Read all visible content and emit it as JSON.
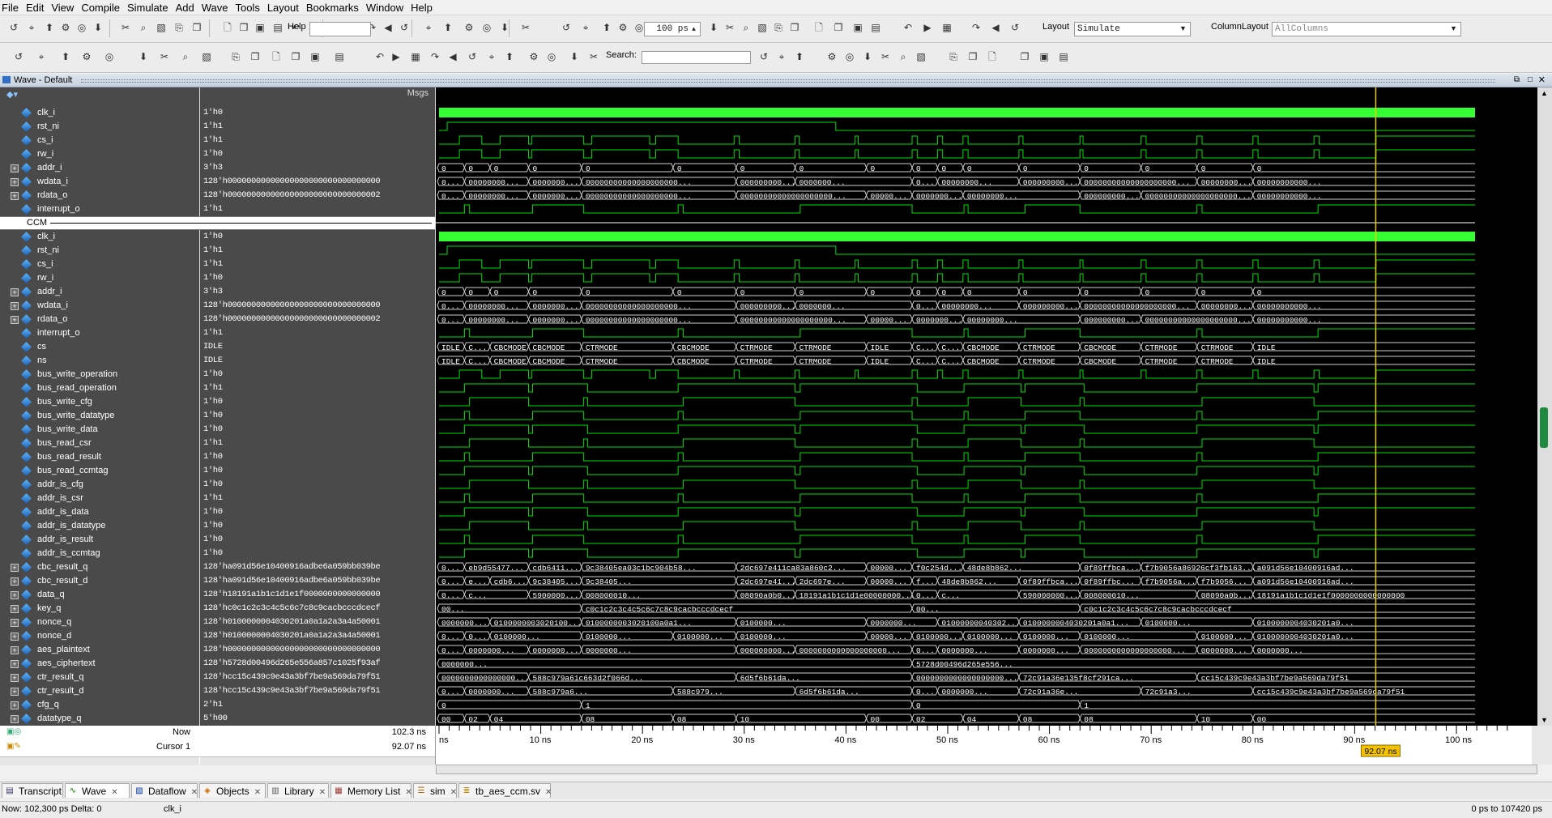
{
  "menu": [
    "File",
    "Edit",
    "View",
    "Compile",
    "Simulate",
    "Add",
    "Wave",
    "Tools",
    "Layout",
    "Bookmarks",
    "Window",
    "Help"
  ],
  "toolbar": {
    "help_label": "Help",
    "time_value": "100 ps",
    "layout_label": "Layout",
    "layout_value": "Simulate",
    "column_layout_label": "ColumnLayout",
    "column_layout_value": "AllColumns",
    "search_label": "Search:"
  },
  "wave_window": {
    "title": "Wave - Default",
    "msgs_header": "Msgs",
    "divider_label": "CCM",
    "signals_top": [
      {
        "name": "clk_i",
        "value": "1'h0",
        "expandable": false
      },
      {
        "name": "rst_ni",
        "value": "1'h1",
        "expandable": false
      },
      {
        "name": "cs_i",
        "value": "1'h1",
        "expandable": false
      },
      {
        "name": "rw_i",
        "value": "1'h0",
        "expandable": false
      },
      {
        "name": "addr_i",
        "value": "3'h3",
        "expandable": true
      },
      {
        "name": "wdata_i",
        "value": "128'h00000000000000000000000000000000",
        "expandable": true
      },
      {
        "name": "rdata_o",
        "value": "128'h00000000000000000000000000000002",
        "expandable": true
      },
      {
        "name": "interrupt_o",
        "value": "1'h1",
        "expandable": false
      }
    ],
    "signals_ccm": [
      {
        "name": "clk_i",
        "value": "1'h0",
        "expandable": false
      },
      {
        "name": "rst_ni",
        "value": "1'h1",
        "expandable": false
      },
      {
        "name": "cs_i",
        "value": "1'h1",
        "expandable": false
      },
      {
        "name": "rw_i",
        "value": "1'h0",
        "expandable": false
      },
      {
        "name": "addr_i",
        "value": "3'h3",
        "expandable": true
      },
      {
        "name": "wdata_i",
        "value": "128'h00000000000000000000000000000000",
        "expandable": true
      },
      {
        "name": "rdata_o",
        "value": "128'h00000000000000000000000000000002",
        "expandable": true
      },
      {
        "name": "interrupt_o",
        "value": "1'h1",
        "expandable": false
      },
      {
        "name": "cs",
        "value": "IDLE",
        "expandable": false
      },
      {
        "name": "ns",
        "value": "IDLE",
        "expandable": false
      },
      {
        "name": "bus_write_operation",
        "value": "1'h0",
        "expandable": false
      },
      {
        "name": "bus_read_operation",
        "value": "1'h1",
        "expandable": false
      },
      {
        "name": "bus_write_cfg",
        "value": "1'h0",
        "expandable": false
      },
      {
        "name": "bus_write_datatype",
        "value": "1'h0",
        "expandable": false
      },
      {
        "name": "bus_write_data",
        "value": "1'h0",
        "expandable": false
      },
      {
        "name": "bus_read_csr",
        "value": "1'h1",
        "expandable": false
      },
      {
        "name": "bus_read_result",
        "value": "1'h0",
        "expandable": false
      },
      {
        "name": "bus_read_ccmtag",
        "value": "1'h0",
        "expandable": false
      },
      {
        "name": "addr_is_cfg",
        "value": "1'h0",
        "expandable": false
      },
      {
        "name": "addr_is_csr",
        "value": "1'h1",
        "expandable": false
      },
      {
        "name": "addr_is_data",
        "value": "1'h0",
        "expandable": false
      },
      {
        "name": "addr_is_datatype",
        "value": "1'h0",
        "expandable": false
      },
      {
        "name": "addr_is_result",
        "value": "1'h0",
        "expandable": false
      },
      {
        "name": "addr_is_ccmtag",
        "value": "1'h0",
        "expandable": false
      },
      {
        "name": "cbc_result_q",
        "value": "128'ha091d56e10400916adbe6a059bb039be",
        "expandable": true
      },
      {
        "name": "cbc_result_d",
        "value": "128'ha091d56e10400916adbe6a059bb039be",
        "expandable": true
      },
      {
        "name": "data_q",
        "value": "128'h18191a1b1c1d1e1f0000000000000000",
        "expandable": true
      },
      {
        "name": "key_q",
        "value": "128'hc0c1c2c3c4c5c6c7c8c9cacbcccdcecf",
        "expandable": true
      },
      {
        "name": "nonce_q",
        "value": "128'h0100000004030201a0a1a2a3a4a50001",
        "expandable": true
      },
      {
        "name": "nonce_d",
        "value": "128'h0100000004030201a0a1a2a3a4a50001",
        "expandable": true
      },
      {
        "name": "aes_plaintext",
        "value": "128'h00000000000000000000000000000000",
        "expandable": true
      },
      {
        "name": "aes_ciphertext",
        "value": "128'h5728d00496d265e556a857c1025f93af",
        "expandable": true
      },
      {
        "name": "ctr_result_q",
        "value": "128'hcc15c439c9e43a3bf7be9a569da79f51",
        "expandable": true
      },
      {
        "name": "ctr_result_d",
        "value": "128'hcc15c439c9e43a3bf7be9a569da79f51",
        "expandable": true
      },
      {
        "name": "cfg_q",
        "value": "2'h1",
        "expandable": true
      },
      {
        "name": "datatype_q",
        "value": "5'h00",
        "expandable": true
      }
    ],
    "bus_labels": {
      "addr_i": [
        "0",
        "0",
        "0",
        "0",
        "0",
        "0",
        "0",
        "0",
        "0",
        "0",
        "0",
        "0",
        "0",
        "0",
        "0",
        "0",
        "0"
      ],
      "wdata_i": [
        "000000...",
        "00000000...",
        "00000000...",
        "00000000000000000000...",
        "00000000000000000000...",
        "0000000...",
        "00000000000...",
        "00000000...",
        "00000000000000000000...",
        "00000000000000000000...",
        "00000000000000000000...",
        "00000000000..."
      ],
      "rdata_o": [
        "000000...",
        "00000000...",
        "00000000...",
        "00000000000000000000...",
        "00000000000000000000...",
        "0000000...",
        "00000000...",
        "00000000...",
        "00000000000000000000...",
        "00000000000000000000...",
        "00000000000..."
      ],
      "cs": [
        "IDLE",
        "CBCMODE",
        "CBCMODE",
        "CBCMODE",
        "CTRMODE",
        "CBCMODE",
        "CTRMODE",
        "CTRMODE",
        "IDLE",
        "CBCMODE",
        "CBCMODE",
        "CBCMODE",
        "CTRMODE",
        "CBCMODE",
        "CTRMODE",
        "CTRMODE",
        "IDLE"
      ],
      "cbc_result_q": [
        "000000000000000000...",
        "eb9d55477...",
        "cdb6411e3...",
        "9c38405ea03c1bc904b58...",
        "2dc697e411ca83a860c2...",
        "000000000000000000...",
        "f0c254d3c...",
        "48de8b862...",
        "0f89ffbca62bc24f13215f...",
        "f7b9056a86926cf3fb163...",
        "a091d56e10400916ad..."
      ],
      "cbc_result_d": [
        "000000000000000000...",
        "eb9d55477...",
        "cdb6411e3...",
        "9c38405ea0...",
        "9c38405...",
        "2dc697e41...",
        "2dc697e...",
        "000000000000000000...",
        "f0c254d3c...",
        "48de8b862...",
        "0f89ffbca62...",
        "0f89ffbc...",
        "f7b9056a8...",
        "f7b9056...",
        "a091d56e10400916ad..."
      ],
      "data_q": [
        "0...",
        "c...",
        "590000000...",
        "008000010...",
        "08090a0b0c0d0e0f10111...",
        "18191a1b1c1d1e000000000000000000",
        "0...",
        "c...",
        "590000000...",
        "008000010...",
        "08090a0b0c0d0e0f10111...",
        "18191a1b1c1d1e1f0000000000000000"
      ],
      "key_q": [
        "00...",
        "c0c1c2c3c4c5c6c7c8c9cacbcccdcecf",
        "00...",
        "c0c1c2c3c4c5c6c7c8c9cacbcccdcecf"
      ],
      "nonce_q": [
        "0000000...",
        "0100000003020100a0a1a2a3a4a50001",
        "0100000003020100a0a1...",
        "0100000...",
        "0000000...",
        "0100000004030201a0a1a2a3a4a50001",
        "0100000004030201a0a1...",
        "0100000...",
        "0100000004030201a0..."
      ],
      "nonce_d": [
        "0000000...",
        "0100000003020100a0a1a2a3a4a50001",
        "0100000...",
        "0100000...",
        "0100000...",
        "0100000...",
        "0000000...",
        "0100000004030201a0a1a2a3a4a50001",
        "0100000...",
        "0100000...",
        "0100000...",
        "0100000...",
        "0100000004030201a0..."
      ],
      "aes_plaintext": [
        "0000000...",
        "0000000...",
        "0000000...",
        "0000000...",
        "0000000000000000000...",
        "0000000000000000000...",
        "0000000...",
        "0000000...",
        "0000000...",
        "0000000000000000000...",
        "0000000...",
        "0000000..."
      ],
      "aes_ciphertext": [
        "0000000...",
        "5728d00496d265e556..."
      ],
      "ctr_result_q": [
        "00000000000000000000000000000000",
        "588c979a61c663d2f066d...",
        "6d5f6b61da...",
        "00000000000000000000000000000000",
        "72c91a36e135f8cf291ca...",
        "cc15c439c9e43a3bf7be9a569da79f51"
      ],
      "ctr_result_d": [
        "00000000000000000000000000000000",
        "0000000...",
        "588c979a6...",
        "588c979...",
        "6d5f6b61da...",
        "00000000000000000000000000000000",
        "0000000...",
        "72c91a36e...",
        "72c91a3...",
        "cc15c439c9e43a3bf7be9a569da79f51"
      ],
      "cfg_q": [
        "0",
        "1",
        "0",
        "1"
      ],
      "datatype_q": [
        "00",
        "02",
        "04",
        "08",
        "08",
        "10",
        "00",
        "02",
        "04",
        "08",
        "08",
        "10",
        "00"
      ]
    }
  },
  "timeline": {
    "now_label": "Now",
    "now_value": "102.3 ns",
    "cursor_label": "Cursor 1",
    "cursor_value": "92.07 ns",
    "cursor_readout": "92.07 ns",
    "cursor_ns": 92.07,
    "ticks": [
      {
        "label": "ns",
        "ns": 0
      },
      {
        "label": "10 ns",
        "ns": 10
      },
      {
        "label": "20 ns",
        "ns": 20
      },
      {
        "label": "30 ns",
        "ns": 30
      },
      {
        "label": "40 ns",
        "ns": 40
      },
      {
        "label": "50 ns",
        "ns": 50
      },
      {
        "label": "60 ns",
        "ns": 60
      },
      {
        "label": "70 ns",
        "ns": 70
      },
      {
        "label": "80 ns",
        "ns": 80
      },
      {
        "label": "90 ns",
        "ns": 90
      },
      {
        "label": "100 ns",
        "ns": 100
      }
    ]
  },
  "tabs": [
    {
      "label": "Transcript",
      "icon": "transcript-icon"
    },
    {
      "label": "Wave",
      "icon": "wave-icon"
    },
    {
      "label": "Dataflow",
      "icon": "dataflow-icon"
    },
    {
      "label": "Objects",
      "icon": "objects-icon"
    },
    {
      "label": "Library",
      "icon": "library-icon"
    },
    {
      "label": "Memory List",
      "icon": "memory-icon"
    },
    {
      "label": "sim",
      "icon": "sim-icon"
    },
    {
      "label": "tb_aes_ccm.sv",
      "icon": "source-file-icon"
    }
  ],
  "status": {
    "now": "Now: 102,300 ps  Delta: 0",
    "signal": "clk_i",
    "range": "0 ps to 107420 ps"
  },
  "colors": {
    "wave": "#00e000",
    "bus": "#d0d0d0",
    "cursor": "#e8d000",
    "clock": "#33ff33"
  }
}
